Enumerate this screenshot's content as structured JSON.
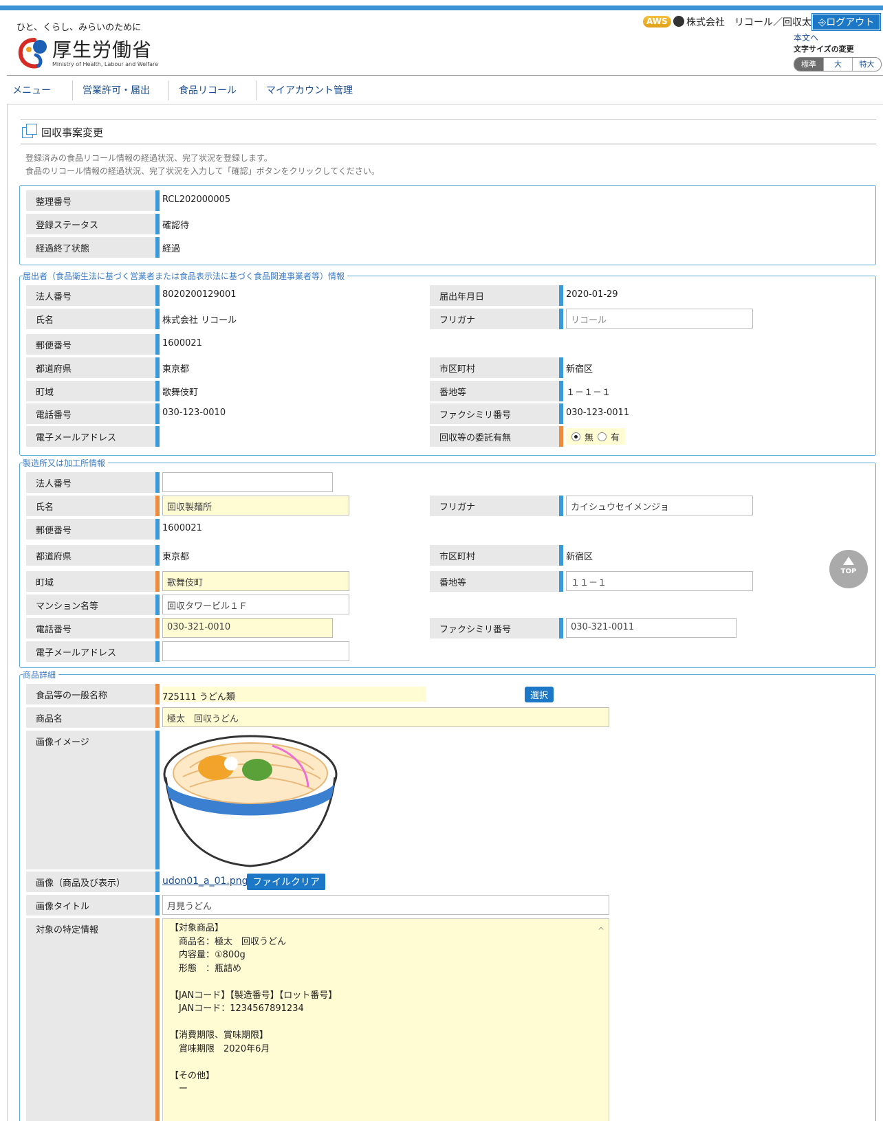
{
  "header": {
    "tagline": "ひと、くらし、みらいのために",
    "ministry": "厚生労働省",
    "ministry_en": "Ministry of Health, Labour and Welfare",
    "aws": "AWS",
    "user": "株式会社　リコール／回収太郎",
    "logout": "ログアウト",
    "honbun": "本文へ",
    "fontsize_label": "文字サイズの変更",
    "fontsize": [
      "標準",
      "大",
      "特大"
    ]
  },
  "nav": [
    "メニュー",
    "営業許可・届出",
    "食品リコール",
    "マイアカウント管理"
  ],
  "page": {
    "title": "回収事案変更",
    "desc1": "登録済みの食品リコール情報の経過状況、完了状況を登録します。",
    "desc2": "食品のリコール情報の経過状況、完了状況を入力して「確認」ボタンをクリックしてください。"
  },
  "status": {
    "seiri_label": "整理番号",
    "seiri": "RCL202000005",
    "touroku_label": "登録ステータス",
    "touroku": "確認待",
    "keika_label": "経過終了状態",
    "keika": "経過"
  },
  "todokede": {
    "legend": "届出者（食品衛生法に基づく営業者または食品表示法に基づく食品関連事業者等）情報",
    "houjin_label": "法人番号",
    "houjin": "8020200129001",
    "date_label": "届出年月日",
    "date": "2020-01-29",
    "name_label": "氏名",
    "name": "株式会社 リコール",
    "kana_label": "フリガナ",
    "kana": "リコール",
    "zip_label": "郵便番号",
    "zip": "1600021",
    "pref_label": "都道府県",
    "pref": "東京都",
    "city_label": "市区町村",
    "city": "新宿区",
    "town_label": "町域",
    "town": "歌舞伎町",
    "banchi_label": "番地等",
    "banchi": "１－１－１",
    "tel_label": "電話番号",
    "tel": "030-123-0010",
    "fax_label": "ファクシミリ番号",
    "fax": "030-123-0011",
    "mail_label": "電子メールアドレス",
    "itaku_label": "回収等の委託有無",
    "itaku_no": "無",
    "itaku_yes": "有"
  },
  "seizou": {
    "legend": "製造所又は加工所情報",
    "houjin_label": "法人番号",
    "houjin": "",
    "name_label": "氏名",
    "name": "回収製麺所",
    "kana_label": "フリガナ",
    "kana": "カイシュウセイメンジョ",
    "zip_label": "郵便番号",
    "zip": "1600021",
    "pref_label": "都道府県",
    "pref": "東京都",
    "city_label": "市区町村",
    "city": "新宿区",
    "town_label": "町域",
    "town": "歌舞伎町",
    "banchi_label": "番地等",
    "banchi": "１１－１",
    "mansion_label": "マンション名等",
    "mansion": "回収タワービル１Ｆ",
    "tel_label": "電話番号",
    "tel": "030-321-0010",
    "fax_label": "ファクシミリ番号",
    "fax": "030-321-0011",
    "mail_label": "電子メールアドレス",
    "mail": ""
  },
  "shouhin": {
    "legend": "商品詳細",
    "ippan_label": "食品等の一般名称",
    "ippan": "725111 うどん類",
    "select_btn": "選択",
    "name_label": "商品名",
    "name": "極太　回収うどん",
    "image_label": "画像イメージ",
    "file_label": "画像（商品及び表示）",
    "file": "udon01_a_01.png",
    "clear_btn": "ファイルクリア",
    "imgtitle_label": "画像タイトル",
    "imgtitle": "月見うどん",
    "tokutei_label": "対象の特定情報",
    "tokutei": "【対象商品】\n　商品名：極太　回収うどん\n　内容量：①800g\n　形態　：瓶詰め\n\n【JANコード】【製造番号】【ロット番号】\n　JANコード：1234567891234\n\n【消費期限、賞味期限】\n　賞味期限　2020年6月\n\n【その他】\n　ー"
  },
  "top_button": "TOP"
}
